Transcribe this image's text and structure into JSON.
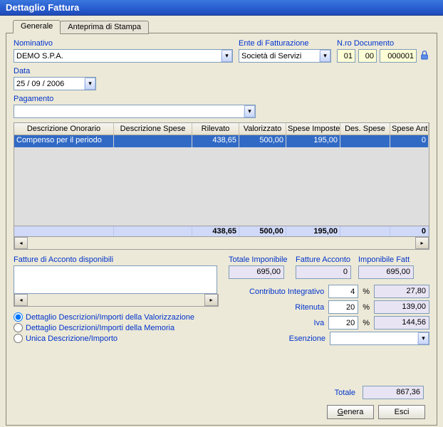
{
  "title": "Dettaglio Fattura",
  "tabs": {
    "generale": "Generale",
    "anteprima": "Anteprima di Stampa"
  },
  "labels": {
    "nominativo": "Nominativo",
    "ente": "Ente di Fatturazione",
    "ndoc": "N.ro Documento",
    "data": "Data",
    "pagamento": "Pagamento",
    "fatture_acconto": "Fatture di Acconto disponibili",
    "totale_imponibile": "Totale Imponibile",
    "fatture_acconto2": "Fatture Acconto",
    "imponibile_fatt": "Imponibile Fatt",
    "contributo": "Contributo Integrativo",
    "ritenuta": "Ritenuta",
    "iva": "Iva",
    "esenzione": "Esenzione",
    "totale": "Totale"
  },
  "nominativo": "DEMO S.P.A.",
  "ente": "Società di Servizi",
  "doc": {
    "a": "01",
    "b": "00",
    "c": "000001"
  },
  "data": "25 / 09 / 2006",
  "pagamento": "",
  "grid": {
    "headers": [
      "Descrizione Onorario",
      "Descrizione Spese",
      "Rilevato",
      "Valorizzato",
      "Spese Imposte",
      "Des. Spese",
      "Spese Anticipate"
    ],
    "row": {
      "descr_on": "Compenso per il periodo",
      "descr_sp": "",
      "rilevato": "438,65",
      "valorizzato": "500,00",
      "spese_imp": "195,00",
      "des_spese": "",
      "spese_ant": "0"
    },
    "totals": {
      "rilevato": "438,65",
      "valorizzato": "500,00",
      "spese_imp": "195,00",
      "spese_ant": "0"
    }
  },
  "radios": {
    "r0": "Dettaglio Descrizioni/Importi della Valorizzazione",
    "r1": "Dettaglio Descrizioni/Importi della Memoria",
    "r2": "Unica Descrizione/Importo"
  },
  "vals": {
    "tot_imponibile": "695,00",
    "fatt_acconto": "0",
    "imponibile_fatt": "695,00",
    "contributo_pct": "4",
    "contributo_val": "27,80",
    "ritenuta_pct": "20",
    "ritenuta_val": "139,00",
    "iva_pct": "20",
    "iva_val": "144,56",
    "esenzione": "",
    "totale": "867,36"
  },
  "buttons": {
    "genera": "Genera",
    "esci": "Esci"
  }
}
